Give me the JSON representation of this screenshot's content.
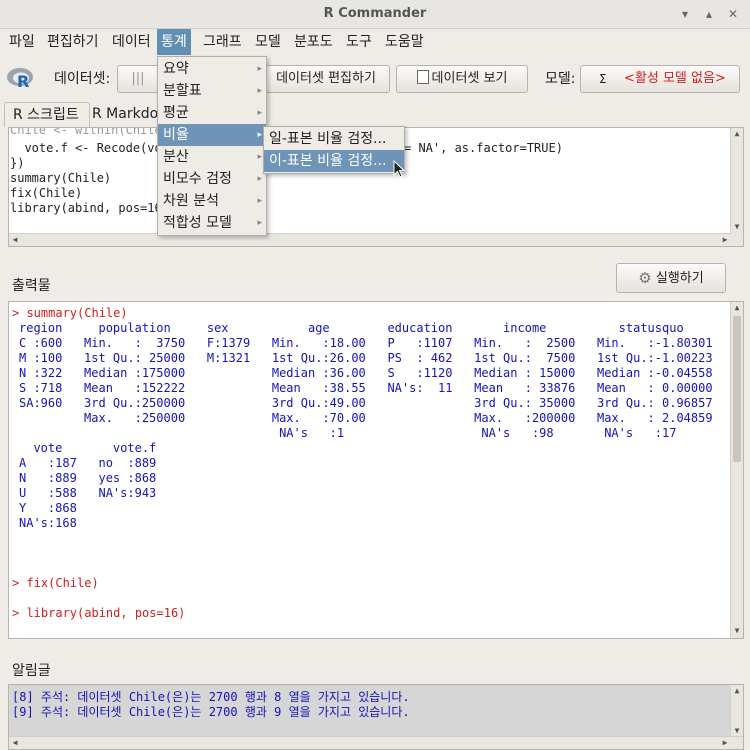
{
  "window": {
    "title": "R Commander"
  },
  "menubar": [
    "파일",
    "편집하기",
    "데이터",
    "통계",
    "그래프",
    "모델",
    "분포도",
    "도구",
    "도움말"
  ],
  "toolbar": {
    "dataset_label": "데이터셋:",
    "dataset_value": "",
    "edit_dataset": "데이터셋 편집하기",
    "view_dataset": "데이터셋 보기",
    "model_label": "모델:",
    "model_sigma": "Σ",
    "model_value": "<활성 모델 없음>"
  },
  "tabs": [
    "R 스크립트",
    "R Markdown"
  ],
  "script_lines": [
    "  vote.f <- Recode(vo",
    "})",
    "summary(Chile)",
    "fix(Chile)",
    "library(abind, pos=16"
  ],
  "script_tail": "= NA', as.factor=TRUE)",
  "output": {
    "label": "출력물",
    "run_button": "실행하기",
    "cmd1": "> summary(Chile)",
    "summary_lines": [
      "region     population     sex           age        education       income          statusquo",
      "C :600   Min.   :  3750   F:1379   Min.   :18.00   P   :1107   Min.   :  2500   Min.   :-1.80301",
      "M :100   1st Qu.: 25000   M:1321   1st Qu.:26.00   PS  : 462   1st Qu.:  7500   1st Qu.:-1.00223",
      "N :322   Median :175000            Median :36.00   S   :1120   Median : 15000   Median :-0.04558",
      "S :718   Mean   :152222            Mean   :38.55   NA's:  11   Mean   : 33876   Mean   : 0.00000",
      "SA:960   3rd Qu.:250000            3rd Qu.:49.00               3rd Qu.: 35000   3rd Qu.: 0.96857",
      "         Max.   :250000            Max.   :70.00               Max.   :200000   Max.   : 2.04859",
      "                                    NA's   :1                   NA's   :98       NA's   :17",
      "  vote       vote.f",
      "A   :187   no  :889",
      "N   :889   yes :868",
      "U   :588   NA's:943",
      "Y   :868",
      "NA's:168"
    ],
    "cmd2": "> fix(Chile)",
    "cmd3": "> library(abind, pos=16)"
  },
  "messages": {
    "label": "알림글",
    "lines": [
      "[8] 주석: 데이터셋 Chile(은)는 2700 행과 8 열을 가지고 있습니다.",
      "[9] 주석: 데이터셋 Chile(은)는 2700 행과 9 열을 가지고 있습니다."
    ]
  },
  "stats_menu": [
    "요약",
    "분할표",
    "평균",
    "비율",
    "분산",
    "비모수 검정",
    "차원 분석",
    "적합성 모델"
  ],
  "proportion_submenu": [
    "일-표본 비율 검정...",
    "이-표본 비율 검정..."
  ],
  "colors": {
    "menu_highlight": "#6e94b8",
    "command": "#d21e1e",
    "output_text": "#1414b8"
  }
}
